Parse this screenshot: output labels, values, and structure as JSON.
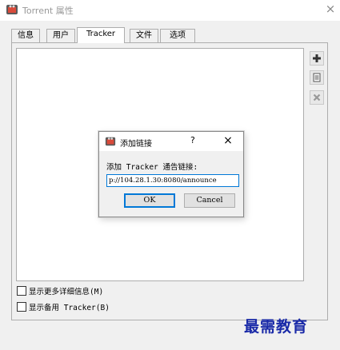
{
  "window": {
    "title": "Torrent 属性",
    "close_glyph": "×"
  },
  "tabs": [
    {
      "label": "信息",
      "active": false
    },
    {
      "label": "用户",
      "active": false
    },
    {
      "label": "Tracker",
      "active": true
    },
    {
      "label": "文件",
      "active": false
    },
    {
      "label": "选项",
      "active": false
    }
  ],
  "side_buttons": [
    {
      "icon": "add-icon"
    },
    {
      "icon": "edit-list-icon"
    },
    {
      "icon": "remove-icon"
    }
  ],
  "options": {
    "show_details": {
      "label": "显示更多详细信息(M)",
      "checked": false
    },
    "show_backup_tracker": {
      "label": "显示备用 Tracker(B)",
      "checked": false
    }
  },
  "dialog": {
    "title": "添加链接",
    "help_glyph": "?",
    "close_glyph": "×",
    "prompt": "添加 Tracker 通告链接:",
    "input_value": "p://104.28.1.30:8080/announce",
    "ok_label": "OK",
    "cancel_label": "Cancel"
  },
  "watermark": "最需教育",
  "colors": {
    "accent": "#0078d7",
    "watermark": "#1a2aa8"
  }
}
